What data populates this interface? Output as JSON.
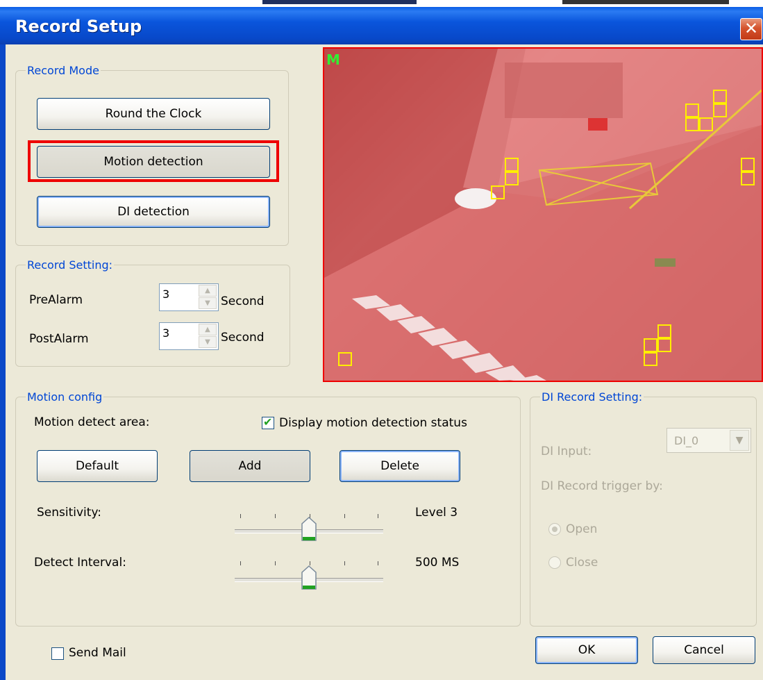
{
  "window": {
    "title": "Record Setup",
    "close_glyph": "✕"
  },
  "record_mode": {
    "legend": "Record Mode",
    "buttons": [
      "Round the Clock",
      "Motion detection",
      "DI detection"
    ]
  },
  "record_setting": {
    "legend": "Record Setting:",
    "pre_label": "PreAlarm",
    "pre_value": "3",
    "pre_unit": "Second",
    "post_label": "PostAlarm",
    "post_value": "3",
    "post_unit": "Second"
  },
  "camera": {
    "overlay_label": "M",
    "overlay_color": "#33ee33",
    "highlight_color": "#e00000"
  },
  "motion_config": {
    "legend": "Motion config",
    "area_label": "Motion detect area:",
    "display_status_label": "Display motion detection status",
    "display_status_checked": true,
    "default_label": "Default",
    "add_label": "Add",
    "delete_label": "Delete",
    "sensitivity_label": "Sensitivity:",
    "sensitivity_value": "Level 3",
    "sensitivity_level": 3,
    "interval_label": "Detect Interval:",
    "interval_value": "500 MS"
  },
  "di_record": {
    "legend": "DI Record Setting:",
    "input_label": "DI Input:",
    "input_value": "DI_0",
    "trigger_label": "DI Record trigger by:",
    "open_label": "Open",
    "close_label": "Close",
    "selected": "Open"
  },
  "send_mail_label": "Send Mail",
  "ok_label": "OK",
  "cancel_label": "Cancel"
}
